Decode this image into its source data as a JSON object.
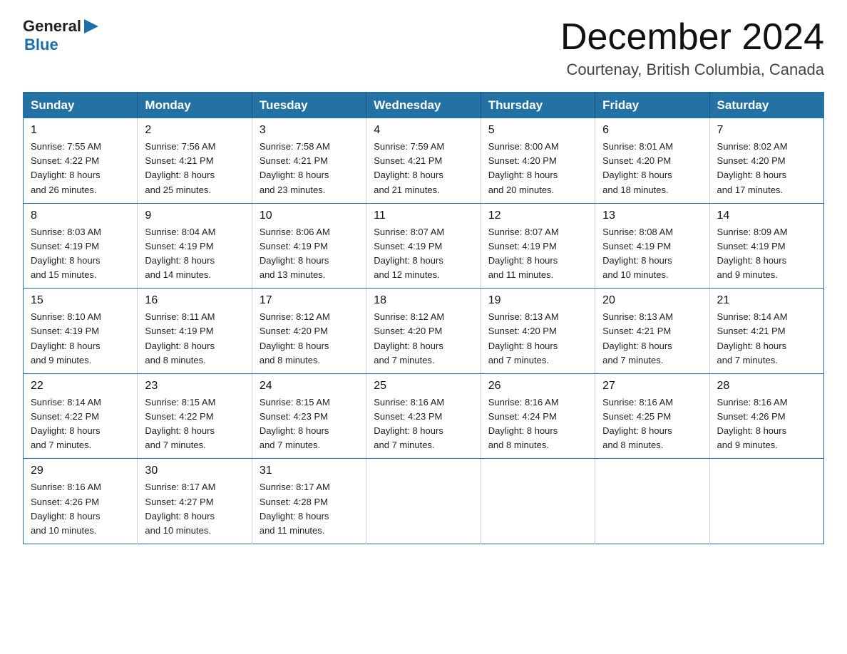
{
  "logo": {
    "general": "General",
    "arrow": "▶",
    "blue": "Blue"
  },
  "title": "December 2024",
  "location": "Courtenay, British Columbia, Canada",
  "weekdays": [
    "Sunday",
    "Monday",
    "Tuesday",
    "Wednesday",
    "Thursday",
    "Friday",
    "Saturday"
  ],
  "weeks": [
    [
      {
        "day": "1",
        "info": "Sunrise: 7:55 AM\nSunset: 4:22 PM\nDaylight: 8 hours\nand 26 minutes."
      },
      {
        "day": "2",
        "info": "Sunrise: 7:56 AM\nSunset: 4:21 PM\nDaylight: 8 hours\nand 25 minutes."
      },
      {
        "day": "3",
        "info": "Sunrise: 7:58 AM\nSunset: 4:21 PM\nDaylight: 8 hours\nand 23 minutes."
      },
      {
        "day": "4",
        "info": "Sunrise: 7:59 AM\nSunset: 4:21 PM\nDaylight: 8 hours\nand 21 minutes."
      },
      {
        "day": "5",
        "info": "Sunrise: 8:00 AM\nSunset: 4:20 PM\nDaylight: 8 hours\nand 20 minutes."
      },
      {
        "day": "6",
        "info": "Sunrise: 8:01 AM\nSunset: 4:20 PM\nDaylight: 8 hours\nand 18 minutes."
      },
      {
        "day": "7",
        "info": "Sunrise: 8:02 AM\nSunset: 4:20 PM\nDaylight: 8 hours\nand 17 minutes."
      }
    ],
    [
      {
        "day": "8",
        "info": "Sunrise: 8:03 AM\nSunset: 4:19 PM\nDaylight: 8 hours\nand 15 minutes."
      },
      {
        "day": "9",
        "info": "Sunrise: 8:04 AM\nSunset: 4:19 PM\nDaylight: 8 hours\nand 14 minutes."
      },
      {
        "day": "10",
        "info": "Sunrise: 8:06 AM\nSunset: 4:19 PM\nDaylight: 8 hours\nand 13 minutes."
      },
      {
        "day": "11",
        "info": "Sunrise: 8:07 AM\nSunset: 4:19 PM\nDaylight: 8 hours\nand 12 minutes."
      },
      {
        "day": "12",
        "info": "Sunrise: 8:07 AM\nSunset: 4:19 PM\nDaylight: 8 hours\nand 11 minutes."
      },
      {
        "day": "13",
        "info": "Sunrise: 8:08 AM\nSunset: 4:19 PM\nDaylight: 8 hours\nand 10 minutes."
      },
      {
        "day": "14",
        "info": "Sunrise: 8:09 AM\nSunset: 4:19 PM\nDaylight: 8 hours\nand 9 minutes."
      }
    ],
    [
      {
        "day": "15",
        "info": "Sunrise: 8:10 AM\nSunset: 4:19 PM\nDaylight: 8 hours\nand 9 minutes."
      },
      {
        "day": "16",
        "info": "Sunrise: 8:11 AM\nSunset: 4:19 PM\nDaylight: 8 hours\nand 8 minutes."
      },
      {
        "day": "17",
        "info": "Sunrise: 8:12 AM\nSunset: 4:20 PM\nDaylight: 8 hours\nand 8 minutes."
      },
      {
        "day": "18",
        "info": "Sunrise: 8:12 AM\nSunset: 4:20 PM\nDaylight: 8 hours\nand 7 minutes."
      },
      {
        "day": "19",
        "info": "Sunrise: 8:13 AM\nSunset: 4:20 PM\nDaylight: 8 hours\nand 7 minutes."
      },
      {
        "day": "20",
        "info": "Sunrise: 8:13 AM\nSunset: 4:21 PM\nDaylight: 8 hours\nand 7 minutes."
      },
      {
        "day": "21",
        "info": "Sunrise: 8:14 AM\nSunset: 4:21 PM\nDaylight: 8 hours\nand 7 minutes."
      }
    ],
    [
      {
        "day": "22",
        "info": "Sunrise: 8:14 AM\nSunset: 4:22 PM\nDaylight: 8 hours\nand 7 minutes."
      },
      {
        "day": "23",
        "info": "Sunrise: 8:15 AM\nSunset: 4:22 PM\nDaylight: 8 hours\nand 7 minutes."
      },
      {
        "day": "24",
        "info": "Sunrise: 8:15 AM\nSunset: 4:23 PM\nDaylight: 8 hours\nand 7 minutes."
      },
      {
        "day": "25",
        "info": "Sunrise: 8:16 AM\nSunset: 4:23 PM\nDaylight: 8 hours\nand 7 minutes."
      },
      {
        "day": "26",
        "info": "Sunrise: 8:16 AM\nSunset: 4:24 PM\nDaylight: 8 hours\nand 8 minutes."
      },
      {
        "day": "27",
        "info": "Sunrise: 8:16 AM\nSunset: 4:25 PM\nDaylight: 8 hours\nand 8 minutes."
      },
      {
        "day": "28",
        "info": "Sunrise: 8:16 AM\nSunset: 4:26 PM\nDaylight: 8 hours\nand 9 minutes."
      }
    ],
    [
      {
        "day": "29",
        "info": "Sunrise: 8:16 AM\nSunset: 4:26 PM\nDaylight: 8 hours\nand 10 minutes."
      },
      {
        "day": "30",
        "info": "Sunrise: 8:17 AM\nSunset: 4:27 PM\nDaylight: 8 hours\nand 10 minutes."
      },
      {
        "day": "31",
        "info": "Sunrise: 8:17 AM\nSunset: 4:28 PM\nDaylight: 8 hours\nand 11 minutes."
      },
      null,
      null,
      null,
      null
    ]
  ]
}
